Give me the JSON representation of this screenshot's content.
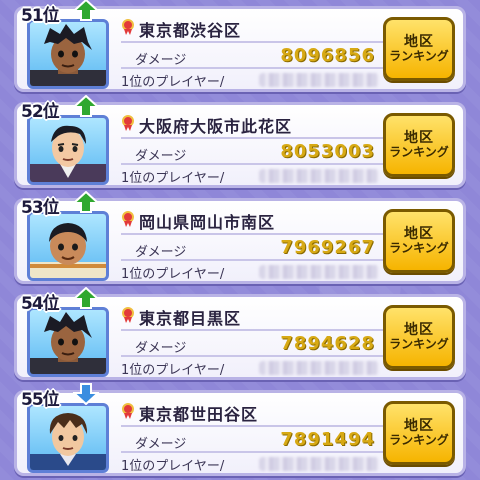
{
  "rows": [
    {
      "rank": "51位",
      "trend": "up",
      "district": "東京都渋谷区",
      "damage_label": "ダメージ",
      "damage": "8096856",
      "player_label": "1位のプレイヤー/",
      "button_line1": "地区",
      "button_line2": "ランキング",
      "avatar": "dark-hair-boy"
    },
    {
      "rank": "52位",
      "trend": "up",
      "district": "大阪府大阪市此花区",
      "damage_label": "ダメージ",
      "damage": "8053003",
      "player_label": "1位のプレイヤー/",
      "button_line1": "地区",
      "button_line2": "ランキング",
      "avatar": "suit-man"
    },
    {
      "rank": "53位",
      "trend": "up",
      "district": "岡山県岡山市南区",
      "damage_label": "ダメージ",
      "damage": "7969267",
      "player_label": "1位のプレイヤー/",
      "button_line1": "地区",
      "button_line2": "ランキング",
      "avatar": "round-boy"
    },
    {
      "rank": "54位",
      "trend": "up",
      "district": "東京都目黒区",
      "damage_label": "ダメージ",
      "damage": "7894628",
      "player_label": "1位のプレイヤー/",
      "button_line1": "地区",
      "button_line2": "ランキング",
      "avatar": "dark-hair-boy"
    },
    {
      "rank": "55位",
      "trend": "down",
      "district": "東京都世田谷区",
      "damage_label": "ダメージ",
      "damage": "7891494",
      "player_label": "1位のプレイヤー/",
      "button_line1": "地区",
      "button_line2": "ランキング",
      "avatar": "brown-hair-boy"
    }
  ],
  "colors": {
    "up": "#2fa82f",
    "down": "#3a8ee0",
    "value": "#d7a914",
    "button": "#f6b400"
  }
}
